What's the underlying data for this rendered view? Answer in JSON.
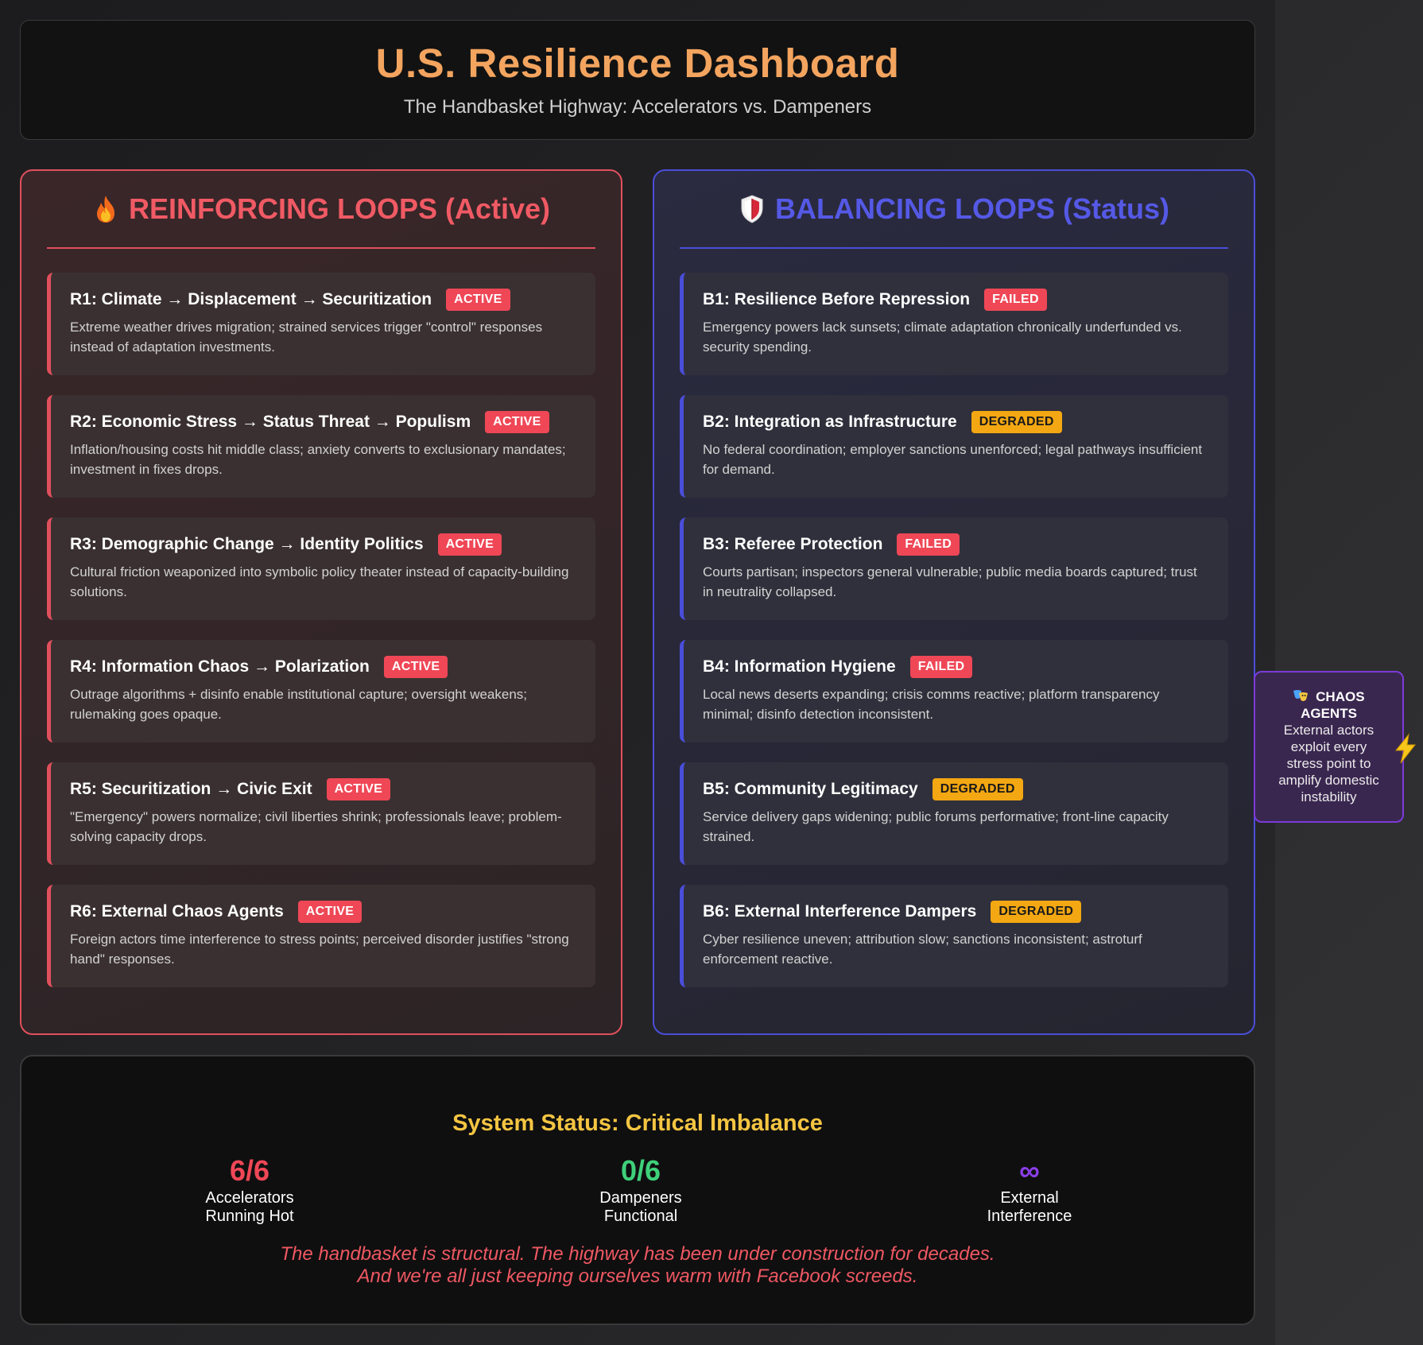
{
  "header": {
    "title": "U.S. Resilience Dashboard",
    "subtitle": "The Handbasket Highway: Accelerators vs. Dampeners"
  },
  "reinforcing": {
    "title": "REINFORCING LOOPS (Active)",
    "icon": "fire-icon",
    "accent_color": "#e0505c",
    "loops": [
      {
        "title": "R1: Climate → Displacement → Securitization",
        "status": "ACTIVE",
        "description": "Extreme weather drives migration; strained services trigger \"control\" responses instead of adaptation investments."
      },
      {
        "title": "R2: Economic Stress → Status Threat → Populism",
        "status": "ACTIVE",
        "description": "Inflation/housing costs hit middle class; anxiety converts to exclusionary mandates; investment in fixes drops."
      },
      {
        "title": "R3: Demographic Change → Identity Politics",
        "status": "ACTIVE",
        "description": "Cultural friction weaponized into symbolic policy theater instead of capacity-building solutions."
      },
      {
        "title": "R4: Information Chaos → Polarization",
        "status": "ACTIVE",
        "description": "Outrage algorithms + disinfo enable institutional capture; oversight weakens; rulemaking goes opaque."
      },
      {
        "title": "R5: Securitization → Civic Exit",
        "status": "ACTIVE",
        "description": "\"Emergency\" powers normalize; civil liberties shrink; professionals leave; problem-solving capacity drops."
      },
      {
        "title": "R6: External Chaos Agents",
        "status": "ACTIVE",
        "description": "Foreign actors time interference to stress points; perceived disorder justifies \"strong hand\" responses."
      }
    ]
  },
  "balancing": {
    "title": "BALANCING LOOPS (Status)",
    "icon": "shield-icon",
    "accent_color": "#4a4ed8",
    "loops": [
      {
        "title": "B1: Resilience Before Repression",
        "status": "FAILED",
        "description": "Emergency powers lack sunsets; climate adaptation chronically underfunded vs. security spending."
      },
      {
        "title": "B2: Integration as Infrastructure",
        "status": "DEGRADED",
        "description": "No federal coordination; employer sanctions unenforced; legal pathways insufficient for demand."
      },
      {
        "title": "B3: Referee Protection",
        "status": "FAILED",
        "description": "Courts partisan; inspectors general vulnerable; public media boards captured; trust in neutrality collapsed."
      },
      {
        "title": "B4: Information Hygiene",
        "status": "FAILED",
        "description": "Local news deserts expanding; crisis comms reactive; platform transparency minimal; disinfo detection inconsistent."
      },
      {
        "title": "B5: Community Legitimacy",
        "status": "DEGRADED",
        "description": "Service delivery gaps widening; public forums performative; front-line capacity strained."
      },
      {
        "title": "B6: External Interference Dampers",
        "status": "DEGRADED",
        "description": "Cyber resilience uneven; attribution slow; sanctions inconsistent; astroturf enforcement reactive."
      }
    ]
  },
  "chaos_agents": {
    "icon": "theater-masks-icon",
    "title_line1": "CHAOS",
    "title_line2": "AGENTS",
    "desc_lines": [
      "External actors",
      "exploit every",
      "stress point to",
      "amplify domestic",
      "instability"
    ],
    "side_icon": "lightning-bolt-icon"
  },
  "status": {
    "title": "System Status: Critical Imbalance",
    "metrics": {
      "accelerators": {
        "value": "6/6",
        "label_line1": "Accelerators",
        "label_line2": "Running Hot",
        "color": "#ef4756"
      },
      "dampeners": {
        "value": "0/6",
        "label_line1": "Dampeners",
        "label_line2": "Functional",
        "color": "#3fd07a"
      },
      "external": {
        "value": "∞",
        "label_line1": "External",
        "label_line2": "Interference",
        "color": "#8a3ee8"
      }
    },
    "quote_line1": "The handbasket is structural. The highway has been under construction for decades.",
    "quote_line2": "And we're all just keeping ourselves warm with Facebook screeds."
  },
  "colors": {
    "badge_active": "#ef4756",
    "badge_failed": "#ef4756",
    "badge_degraded": "#f3a712",
    "header_title": "#f3a45f",
    "status_title": "#f5c542"
  }
}
